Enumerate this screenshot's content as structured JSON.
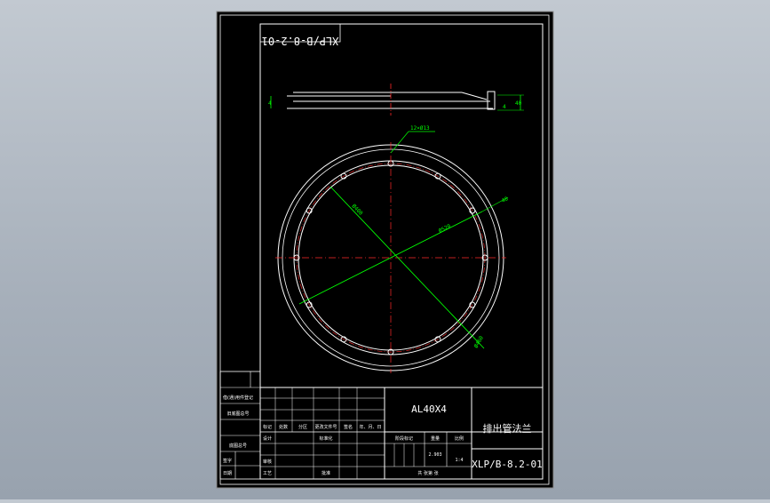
{
  "drawing": {
    "mirrored_number": "XLP/B-8.2-01",
    "bolt_holes_label": "12×Ø13",
    "dim_inner_diameter": "Ø400",
    "dim_outer_diameter": "Ø520",
    "dim_bolt_circle": "Ø460",
    "dim_rim": "40",
    "dim_height": "4",
    "dim_lip": "4",
    "dim_offset": "40",
    "side_height": "4"
  },
  "title_block": {
    "material": "AL40X4",
    "part_name": "排出管法兰",
    "drawing_number": "XLP/B-8.2-01",
    "scale": "1:4",
    "weight": "2.903",
    "col_headers": [
      "标记",
      "处数",
      "分区",
      "更改文件号",
      "签名",
      "年、月、日"
    ],
    "row_design": "设计",
    "row_standard": "标准化",
    "row_review": "审核",
    "row_process": "工艺",
    "row_approve": "批准",
    "stage_mark": "阶段标记",
    "weight_label": "重量",
    "scale_label": "比例",
    "sheet_text": "共    张第    张"
  },
  "side_strip": {
    "rows": [
      "借(通)用件登记",
      "旧底图总号",
      "底图总号",
      "签字",
      "日期"
    ]
  },
  "colors": {
    "background": "#000000",
    "lines": "#ffffff",
    "dimensions": "#00ff00",
    "centerlines": "#ff2a2a"
  }
}
